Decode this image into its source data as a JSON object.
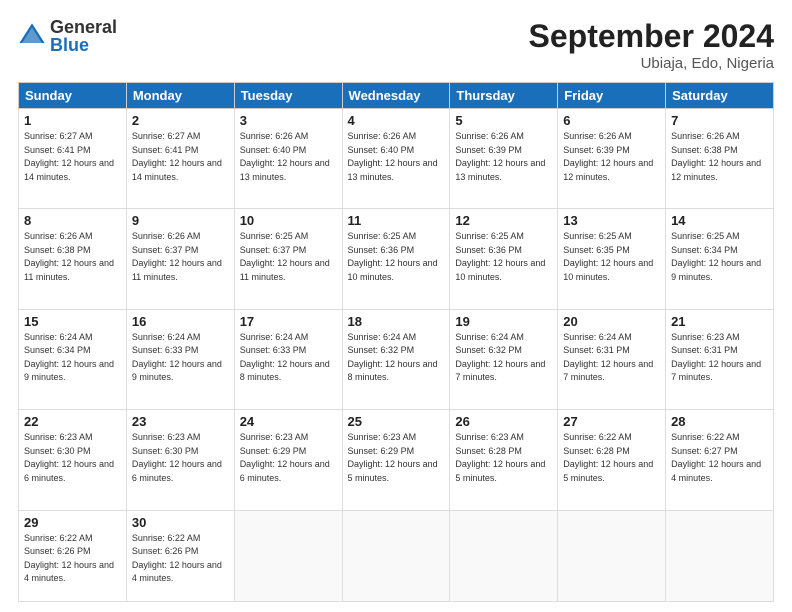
{
  "logo": {
    "general": "General",
    "blue": "Blue"
  },
  "title": "September 2024",
  "location": "Ubiaja, Edo, Nigeria",
  "days_of_week": [
    "Sunday",
    "Monday",
    "Tuesday",
    "Wednesday",
    "Thursday",
    "Friday",
    "Saturday"
  ],
  "weeks": [
    [
      {
        "day": "1",
        "sunrise": "6:27 AM",
        "sunset": "6:41 PM",
        "daylight": "12 hours and 14 minutes."
      },
      {
        "day": "2",
        "sunrise": "6:27 AM",
        "sunset": "6:41 PM",
        "daylight": "12 hours and 14 minutes."
      },
      {
        "day": "3",
        "sunrise": "6:26 AM",
        "sunset": "6:40 PM",
        "daylight": "12 hours and 13 minutes."
      },
      {
        "day": "4",
        "sunrise": "6:26 AM",
        "sunset": "6:40 PM",
        "daylight": "12 hours and 13 minutes."
      },
      {
        "day": "5",
        "sunrise": "6:26 AM",
        "sunset": "6:39 PM",
        "daylight": "12 hours and 13 minutes."
      },
      {
        "day": "6",
        "sunrise": "6:26 AM",
        "sunset": "6:39 PM",
        "daylight": "12 hours and 12 minutes."
      },
      {
        "day": "7",
        "sunrise": "6:26 AM",
        "sunset": "6:38 PM",
        "daylight": "12 hours and 12 minutes."
      }
    ],
    [
      {
        "day": "8",
        "sunrise": "6:26 AM",
        "sunset": "6:38 PM",
        "daylight": "12 hours and 11 minutes."
      },
      {
        "day": "9",
        "sunrise": "6:26 AM",
        "sunset": "6:37 PM",
        "daylight": "12 hours and 11 minutes."
      },
      {
        "day": "10",
        "sunrise": "6:25 AM",
        "sunset": "6:37 PM",
        "daylight": "12 hours and 11 minutes."
      },
      {
        "day": "11",
        "sunrise": "6:25 AM",
        "sunset": "6:36 PM",
        "daylight": "12 hours and 10 minutes."
      },
      {
        "day": "12",
        "sunrise": "6:25 AM",
        "sunset": "6:36 PM",
        "daylight": "12 hours and 10 minutes."
      },
      {
        "day": "13",
        "sunrise": "6:25 AM",
        "sunset": "6:35 PM",
        "daylight": "12 hours and 10 minutes."
      },
      {
        "day": "14",
        "sunrise": "6:25 AM",
        "sunset": "6:34 PM",
        "daylight": "12 hours and 9 minutes."
      }
    ],
    [
      {
        "day": "15",
        "sunrise": "6:24 AM",
        "sunset": "6:34 PM",
        "daylight": "12 hours and 9 minutes."
      },
      {
        "day": "16",
        "sunrise": "6:24 AM",
        "sunset": "6:33 PM",
        "daylight": "12 hours and 9 minutes."
      },
      {
        "day": "17",
        "sunrise": "6:24 AM",
        "sunset": "6:33 PM",
        "daylight": "12 hours and 8 minutes."
      },
      {
        "day": "18",
        "sunrise": "6:24 AM",
        "sunset": "6:32 PM",
        "daylight": "12 hours and 8 minutes."
      },
      {
        "day": "19",
        "sunrise": "6:24 AM",
        "sunset": "6:32 PM",
        "daylight": "12 hours and 7 minutes."
      },
      {
        "day": "20",
        "sunrise": "6:24 AM",
        "sunset": "6:31 PM",
        "daylight": "12 hours and 7 minutes."
      },
      {
        "day": "21",
        "sunrise": "6:23 AM",
        "sunset": "6:31 PM",
        "daylight": "12 hours and 7 minutes."
      }
    ],
    [
      {
        "day": "22",
        "sunrise": "6:23 AM",
        "sunset": "6:30 PM",
        "daylight": "12 hours and 6 minutes."
      },
      {
        "day": "23",
        "sunrise": "6:23 AM",
        "sunset": "6:30 PM",
        "daylight": "12 hours and 6 minutes."
      },
      {
        "day": "24",
        "sunrise": "6:23 AM",
        "sunset": "6:29 PM",
        "daylight": "12 hours and 6 minutes."
      },
      {
        "day": "25",
        "sunrise": "6:23 AM",
        "sunset": "6:29 PM",
        "daylight": "12 hours and 5 minutes."
      },
      {
        "day": "26",
        "sunrise": "6:23 AM",
        "sunset": "6:28 PM",
        "daylight": "12 hours and 5 minutes."
      },
      {
        "day": "27",
        "sunrise": "6:22 AM",
        "sunset": "6:28 PM",
        "daylight": "12 hours and 5 minutes."
      },
      {
        "day": "28",
        "sunrise": "6:22 AM",
        "sunset": "6:27 PM",
        "daylight": "12 hours and 4 minutes."
      }
    ],
    [
      {
        "day": "29",
        "sunrise": "6:22 AM",
        "sunset": "6:26 PM",
        "daylight": "12 hours and 4 minutes."
      },
      {
        "day": "30",
        "sunrise": "6:22 AM",
        "sunset": "6:26 PM",
        "daylight": "12 hours and 4 minutes."
      },
      null,
      null,
      null,
      null,
      null
    ]
  ]
}
